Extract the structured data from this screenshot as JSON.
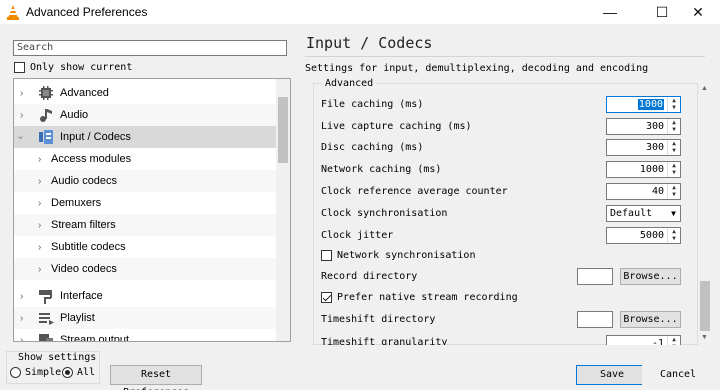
{
  "window": {
    "title": "Advanced Preferences",
    "controls": {
      "minimize": "—",
      "maximize": "☐",
      "close": "✕"
    }
  },
  "left": {
    "search_placeholder": "Search",
    "only_current_label": "Only show current",
    "only_current_checked": false,
    "tree": [
      {
        "label": "Advanced",
        "level": 0,
        "expanded": false,
        "icon": "advanced-icon"
      },
      {
        "label": "Audio",
        "level": 0,
        "expanded": false,
        "icon": "audio-icon"
      },
      {
        "label": "Input / Codecs",
        "level": 0,
        "expanded": true,
        "selected": true,
        "icon": "input-codecs-icon"
      },
      {
        "label": "Access modules",
        "level": 1
      },
      {
        "label": "Audio codecs",
        "level": 1
      },
      {
        "label": "Demuxers",
        "level": 1
      },
      {
        "label": "Stream filters",
        "level": 1
      },
      {
        "label": "Subtitle codecs",
        "level": 1
      },
      {
        "label": "Video codecs",
        "level": 1
      },
      {
        "label": "Interface",
        "level": 0,
        "expanded": false,
        "icon": "interface-icon"
      },
      {
        "label": "Playlist",
        "level": 0,
        "expanded": false,
        "icon": "playlist-icon"
      },
      {
        "label": "Stream output",
        "level": 0,
        "expanded": false,
        "icon": "stream-output-icon"
      }
    ]
  },
  "right": {
    "title": "Input / Codecs",
    "subtitle": "Settings for input, demultiplexing, decoding and encoding",
    "group_label": "Advanced",
    "options": {
      "file_caching": {
        "label": "File caching (ms)",
        "value": "1000"
      },
      "live_capture_caching": {
        "label": "Live capture caching (ms)",
        "value": "300"
      },
      "disc_caching": {
        "label": "Disc caching (ms)",
        "value": "300"
      },
      "network_caching": {
        "label": "Network caching (ms)",
        "value": "1000"
      },
      "clock_ref_avg": {
        "label": "Clock reference average counter",
        "value": "40"
      },
      "clock_sync": {
        "label": "Clock synchronisation",
        "value": "Default"
      },
      "clock_jitter": {
        "label": "Clock jitter",
        "value": "5000"
      },
      "network_sync": {
        "label": "Network synchronisation",
        "checked": false
      },
      "record_directory": {
        "label": "Record directory",
        "value": ""
      },
      "prefer_native": {
        "label": "Prefer native stream recording",
        "checked": true
      },
      "timeshift_directory": {
        "label": "Timeshift directory",
        "value": ""
      },
      "timeshift_granularity": {
        "label": "Timeshift granularity",
        "value": "-1"
      }
    },
    "browse_label": "Browse..."
  },
  "bottom": {
    "show_settings_label": "Show settings",
    "simple_label": "Simple",
    "all_label": "All",
    "selected_mode": "All",
    "reset_label": "Reset Preferences",
    "save_label": "Save",
    "cancel_label": "Cancel"
  },
  "colors": {
    "accent": "#0078d7",
    "selection": "#d9d9d9",
    "vlc_orange": "#f08a00"
  }
}
